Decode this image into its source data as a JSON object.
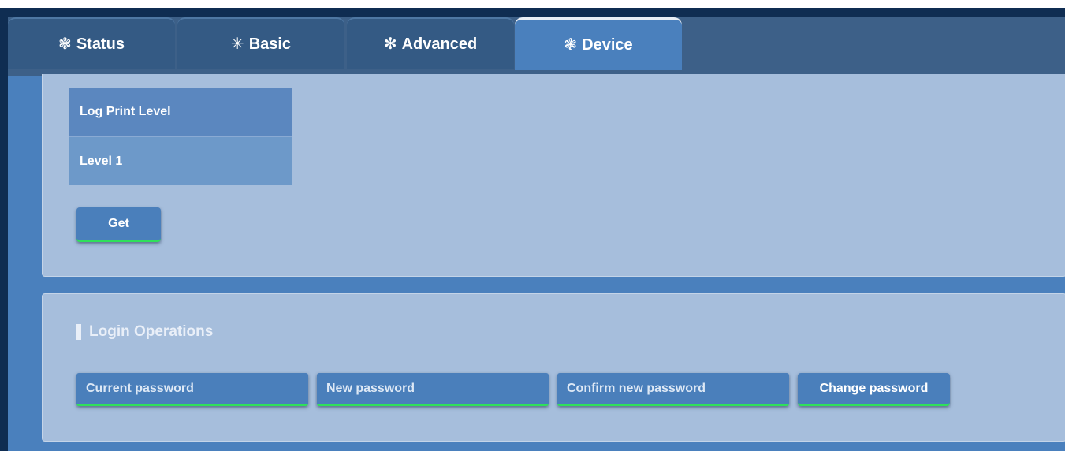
{
  "tabs": [
    {
      "label": "Status",
      "icon": "gear-icon",
      "glyph": "❃"
    },
    {
      "label": "Basic",
      "icon": "asterisk-icon",
      "glyph": "✳"
    },
    {
      "label": "Advanced",
      "icon": "asterisk-icon",
      "glyph": "✻"
    },
    {
      "label": "Device",
      "icon": "gear-icon",
      "glyph": "❃"
    }
  ],
  "active_tab": "Device",
  "log": {
    "header": "Log Print Level",
    "value": "Level 1",
    "get_label": "Get"
  },
  "login": {
    "title": "Login Operations",
    "current_password_placeholder": "Current password",
    "new_password_placeholder": "New password",
    "confirm_password_placeholder": "Confirm new password",
    "change_label": "Change password"
  },
  "colors": {
    "accent_underline": "#2fe05a",
    "panel": "#a6bedc",
    "frame": "#4a80bd"
  }
}
